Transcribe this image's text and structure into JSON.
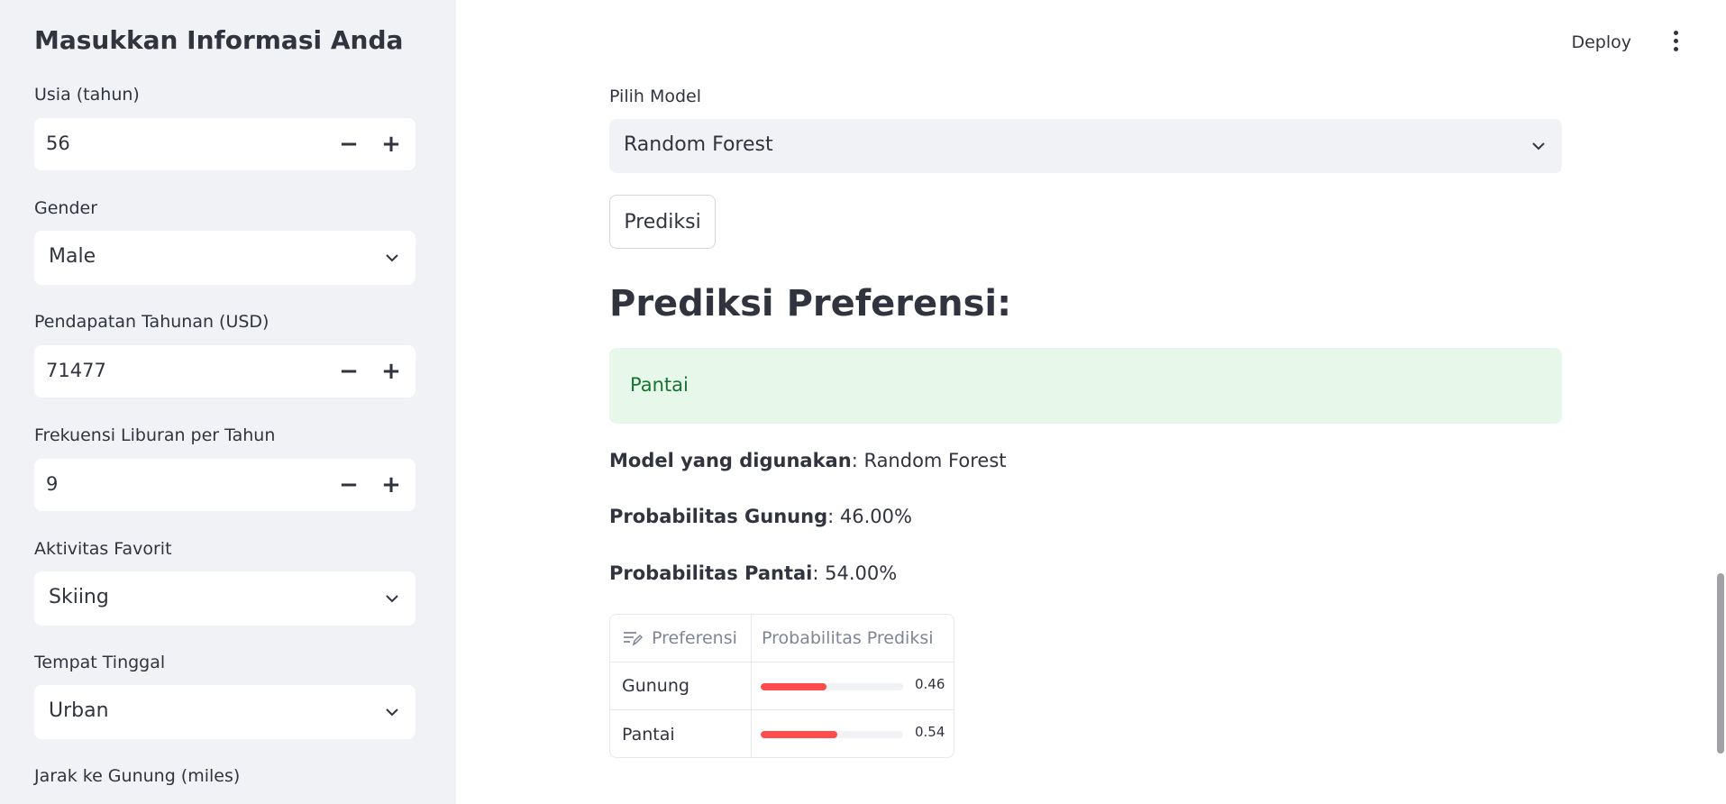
{
  "sidebar": {
    "title": "Masukkan Informasi Anda",
    "age": {
      "label": "Usia (tahun)",
      "value": "56",
      "minus": "−",
      "plus": "+"
    },
    "gender": {
      "label": "Gender",
      "value": "Male"
    },
    "income": {
      "label": "Pendapatan Tahunan (USD)",
      "value": "71477",
      "minus": "−",
      "plus": "+"
    },
    "freq": {
      "label": "Frekuensi Liburan per Tahun",
      "value": "9",
      "minus": "−",
      "plus": "+"
    },
    "activity": {
      "label": "Aktivitas Favorit",
      "value": "Skiing"
    },
    "residence": {
      "label": "Tempat Tinggal",
      "value": "Urban"
    },
    "distance": {
      "label": "Jarak ke Gunung (miles)"
    }
  },
  "header": {
    "deploy_label": "Deploy"
  },
  "main": {
    "model_label": "Pilih Model",
    "model_value": "Random Forest",
    "predict_button": "Prediksi",
    "result_heading": "Prediksi Preferensi:",
    "result_value": "Pantai",
    "model_used_label": "Model yang digunakan",
    "model_used_value": ": Random Forest",
    "prob_gunung_label": "Probabilitas Gunung",
    "prob_gunung_value": ": 46.00%",
    "prob_pantai_label": "Probabilitas Pantai",
    "prob_pantai_value": ": 54.00%"
  },
  "table": {
    "columns": [
      "Preferensi",
      "Probabilitas Prediksi"
    ],
    "rows": [
      {
        "label": "Gunung",
        "value": 0.46,
        "value_text": "0.46"
      },
      {
        "label": "Pantai",
        "value": 0.54,
        "value_text": "0.54"
      }
    ],
    "bar_color": "#ff4b4b"
  },
  "colors": {
    "accent": "#ff4b4b",
    "success_bg": "#e7f8ea",
    "success_text": "#177233",
    "sidebar_bg": "#f0f2f6"
  }
}
